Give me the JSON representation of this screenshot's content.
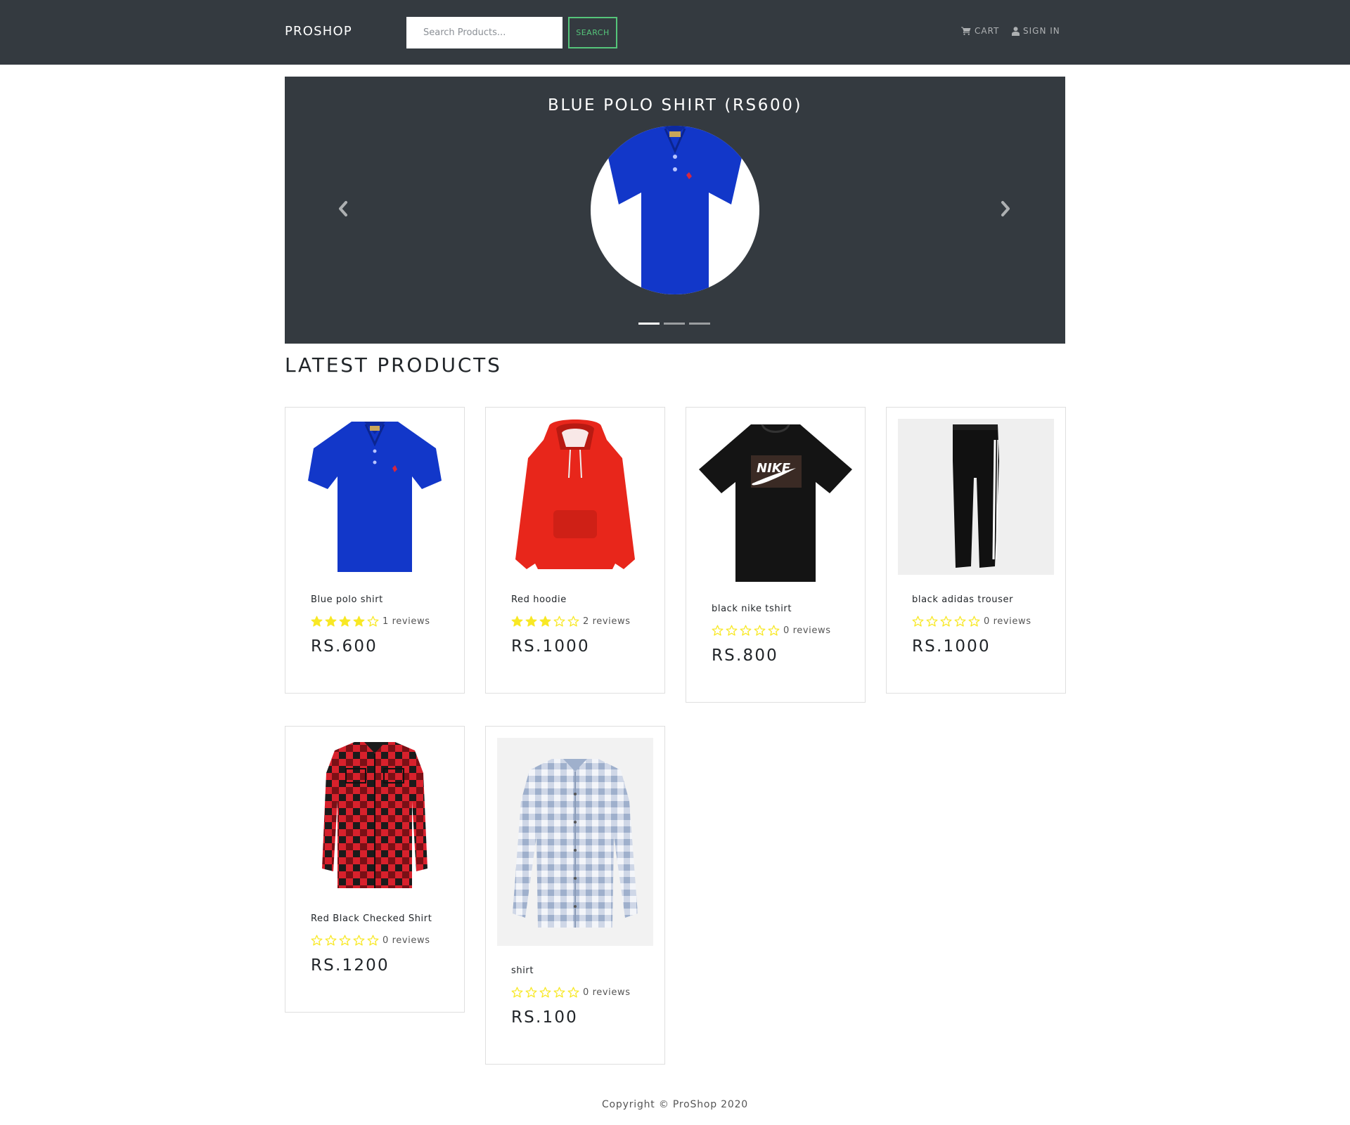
{
  "header": {
    "brand": "PROSHOP",
    "search_placeholder": "Search Products...",
    "search_button": "SEARCH",
    "cart_label": "CART",
    "signin_label": "SIGN IN"
  },
  "carousel": {
    "caption": "BLUE POLO SHIRT (RS600)",
    "image_icon": "blue-polo-shirt",
    "indicators": 3,
    "active_indicator": 0
  },
  "section_title": "LATEST PRODUCTS",
  "products": [
    {
      "name": "Blue polo shirt",
      "rating": 4,
      "reviews_text": "1 reviews",
      "price": "RS.600",
      "image": "blue-polo-shirt"
    },
    {
      "name": "Red hoodie",
      "rating": 3,
      "reviews_text": "2 reviews",
      "price": "RS.1000",
      "image": "red-hoodie"
    },
    {
      "name": "black nike tshirt",
      "rating": 0,
      "reviews_text": "0 reviews",
      "price": "RS.800",
      "image": "black-nike-tshirt"
    },
    {
      "name": "black adidas trouser",
      "rating": 0,
      "reviews_text": "0 reviews",
      "price": "RS.1000",
      "image": "black-adidas-trouser"
    },
    {
      "name": "Red Black Checked Shirt",
      "rating": 0,
      "reviews_text": "0 reviews",
      "price": "RS.1200",
      "image": "red-black-checked-shirt"
    },
    {
      "name": "shirt",
      "rating": 0,
      "reviews_text": "0 reviews",
      "price": "RS.100",
      "image": "blue-checked-shirt"
    }
  ],
  "colors": {
    "navbar": "#343a40",
    "accent": "#55c57a",
    "star": "#f8e825"
  },
  "footer": "Copyright © ProShop 2020"
}
